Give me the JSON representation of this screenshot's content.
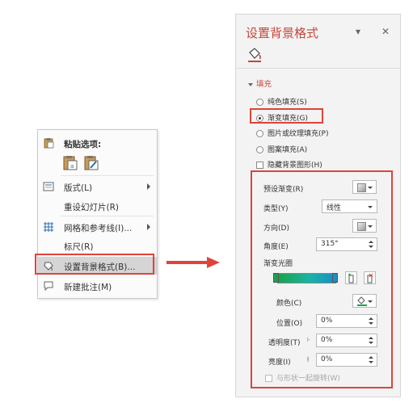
{
  "context_menu": {
    "paste_header": "粘贴选项:",
    "items": [
      {
        "label": "版式(L)",
        "icon": "layout-icon",
        "submenu": true
      },
      {
        "label": "重设幻灯片(R)",
        "icon": "",
        "submenu": false
      },
      {
        "label": "网格和参考线(I)...",
        "icon": "grid-icon",
        "submenu": true
      },
      {
        "label": "标尺(R)",
        "icon": "",
        "submenu": false
      },
      {
        "label": "设置背景格式(B)...",
        "icon": "format-background-icon",
        "submenu": false,
        "highlighted": true
      },
      {
        "label": "新建批注(M)",
        "icon": "comment-icon",
        "submenu": false
      }
    ]
  },
  "pane": {
    "title": "设置背景格式",
    "section": "填充",
    "fill_options": [
      {
        "label": "纯色填充(S)",
        "selected": false
      },
      {
        "label": "渐变填充(G)",
        "selected": true
      },
      {
        "label": "图片或纹理填充(P)",
        "selected": false
      },
      {
        "label": "图案填充(A)",
        "selected": false
      }
    ],
    "hide_background_label": "隐藏背景图形(H)",
    "preset_gradient_label": "预设渐变(R)",
    "type_label": "类型(Y)",
    "type_value": "线性",
    "direction_label": "方向(D)",
    "angle_label": "角度(E)",
    "angle_value": "315°",
    "gradient_stops_label": "渐变光圈",
    "color_label": "颜色(C)",
    "position_label": "位置(O)",
    "position_value": "0%",
    "transparency_label": "透明度(T)",
    "transparency_value": "0%",
    "brightness_label": "亮度(I)",
    "brightness_value": "0%",
    "rotate_with_shape_label": "与形状一起旋转(W)"
  },
  "colors": {
    "accent": "#c4473a",
    "highlight_box": "#e0433a",
    "gradient_start": "#1aa34a",
    "gradient_end": "#1a8ec9"
  }
}
